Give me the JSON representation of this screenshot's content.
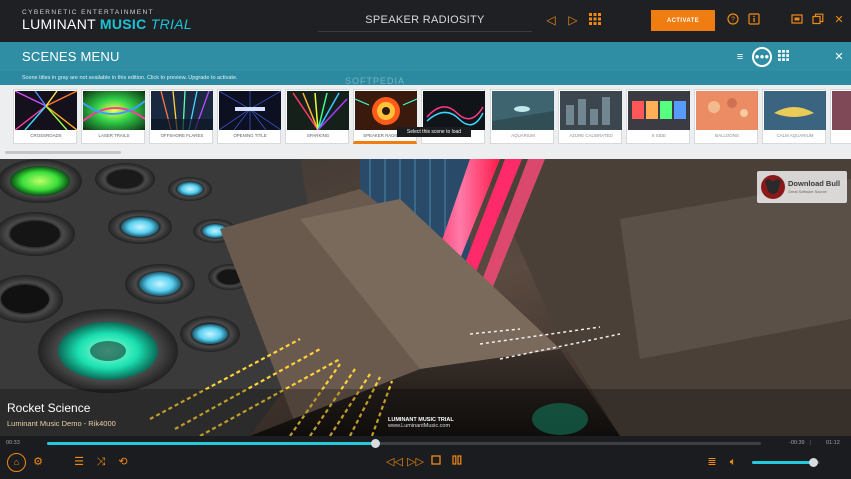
{
  "app": {
    "brand_top": "CYBERNETIC ENTERTAINMENT",
    "brand_name": "LUMINANT",
    "brand_accent": "MUSIC",
    "brand_trial": "TRIAL",
    "current_scene": "SPEAKER RADIOSITY",
    "activate_label": "ACTIVATE"
  },
  "scenes_menu": {
    "title": "SCENES MENU",
    "notice": "Scene titles in gray are not available in this edition. Click to preview. Upgrade to activate.",
    "watermark": "SOFTPEDIA",
    "tooltip": "Select this scene to load",
    "progress_fraction_scroll": 0.14,
    "scenes": [
      {
        "label": "CROSSROADS",
        "available": true
      },
      {
        "label": "LASER TRAILS",
        "available": true
      },
      {
        "label": "OFFSHORE FLARES",
        "available": true
      },
      {
        "label": "OPENING TITLE",
        "available": true
      },
      {
        "label": "SPARKING",
        "available": true
      },
      {
        "label": "SPEAKER RADIOSITY",
        "available": true,
        "active": true
      },
      {
        "label": "ION",
        "available": true
      },
      {
        "label": "AQUARIUM",
        "available": false
      },
      {
        "label": "AZURE CALIBRATED",
        "available": false
      },
      {
        "label": "8 SIDE",
        "available": false
      },
      {
        "label": "BALLOONS",
        "available": false
      },
      {
        "label": "CALM AQUARIUM",
        "available": false
      },
      {
        "label": "CR",
        "available": false
      }
    ]
  },
  "visual": {
    "track_title": "Rocket Science",
    "track_subtitle": "Luminant Music Demo - Rik4000",
    "center_title": "LUMINANT MUSIC TRIAL",
    "center_url": "www.LuminantMusic.com",
    "overlay_logo_title": "Download Bull",
    "overlay_logo_sub": "Great Software Source"
  },
  "player": {
    "elapsed": "00:33",
    "remaining": "-00:39",
    "total": "01:12",
    "progress": 0.459,
    "volume": 0.9
  },
  "colors": {
    "accent_orange": "#f07d12",
    "accent_cyan": "#25c9dc",
    "menu_teal": "#2f8ea4"
  },
  "icons": [
    "prev-icon",
    "next-icon",
    "grid-icon",
    "help-icon",
    "info-icon",
    "fullscreen-icon",
    "restore-icon",
    "close-icon",
    "list-icon",
    "carousel-icon",
    "home-icon",
    "gear-icon",
    "playlist-icon",
    "shuffle-icon",
    "repeat-icon",
    "rewind-icon",
    "forward-icon",
    "stop-icon",
    "pause-icon",
    "equalizer-icon",
    "volume-icon"
  ]
}
